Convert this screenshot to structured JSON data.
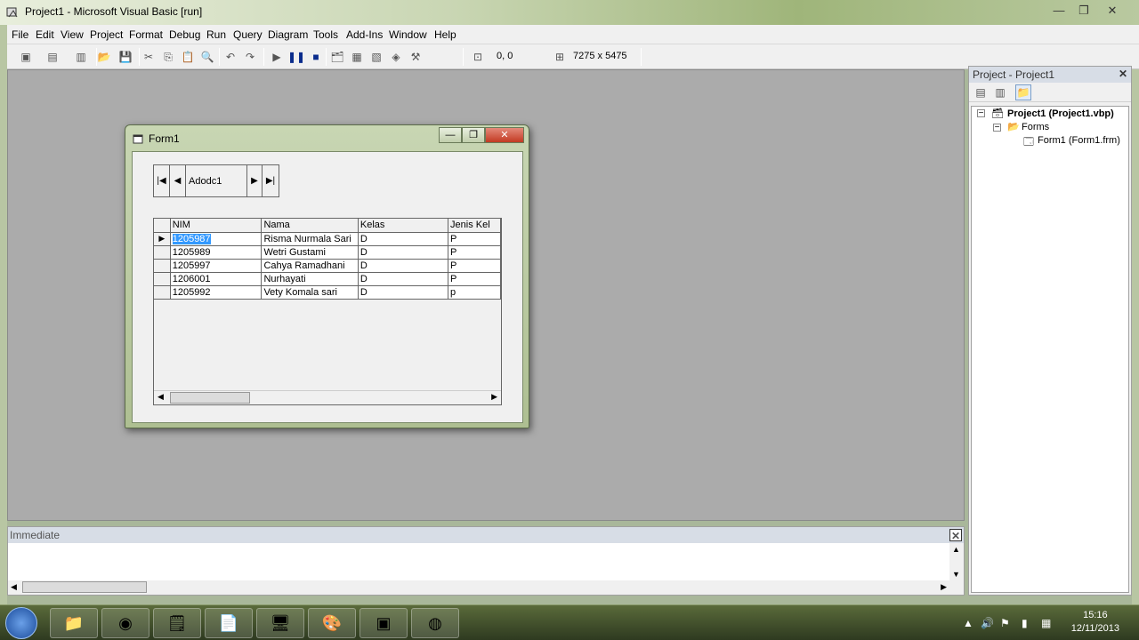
{
  "window": {
    "title": "Project1 - Microsoft Visual Basic [run]",
    "minimize": "—",
    "maximize": "❐",
    "close": "✕"
  },
  "menu": [
    "File",
    "Edit",
    "View",
    "Project",
    "Format",
    "Debug",
    "Run",
    "Query",
    "Diagram",
    "Tools",
    "Add-Ins",
    "Window",
    "Help"
  ],
  "toolbar": {
    "position": "0, 0",
    "size": "7275 x 5475"
  },
  "form1": {
    "title": "Form1",
    "adodc": {
      "caption": "Adodc1"
    },
    "grid": {
      "columns": [
        "NIM",
        "Nama",
        "Kelas",
        "Jenis Kel"
      ],
      "rows": [
        [
          "1205987",
          "Risma Nurmala Sari",
          "D",
          "P"
        ],
        [
          "1205989",
          "Wetri Gustami",
          "D",
          "P"
        ],
        [
          "1205997",
          "Cahya Ramadhani",
          "D",
          "P"
        ],
        [
          "1206001",
          "Nurhayati",
          "D",
          "P"
        ],
        [
          "1205992",
          "Vety Komala sari",
          "D",
          "p"
        ]
      ]
    }
  },
  "project": {
    "title": "Project - Project1",
    "tree": {
      "root": "Project1 (Project1.vbp)",
      "folder": "Forms",
      "item": "Form1 (Form1.frm)"
    }
  },
  "immediate": {
    "title": "Immediate"
  },
  "taskbar": {
    "time": "15:16",
    "date": "12/11/2013"
  },
  "colors": {
    "selection": "#3399ff",
    "workspace": "#ababab",
    "panel_header": "#d7dde6"
  }
}
